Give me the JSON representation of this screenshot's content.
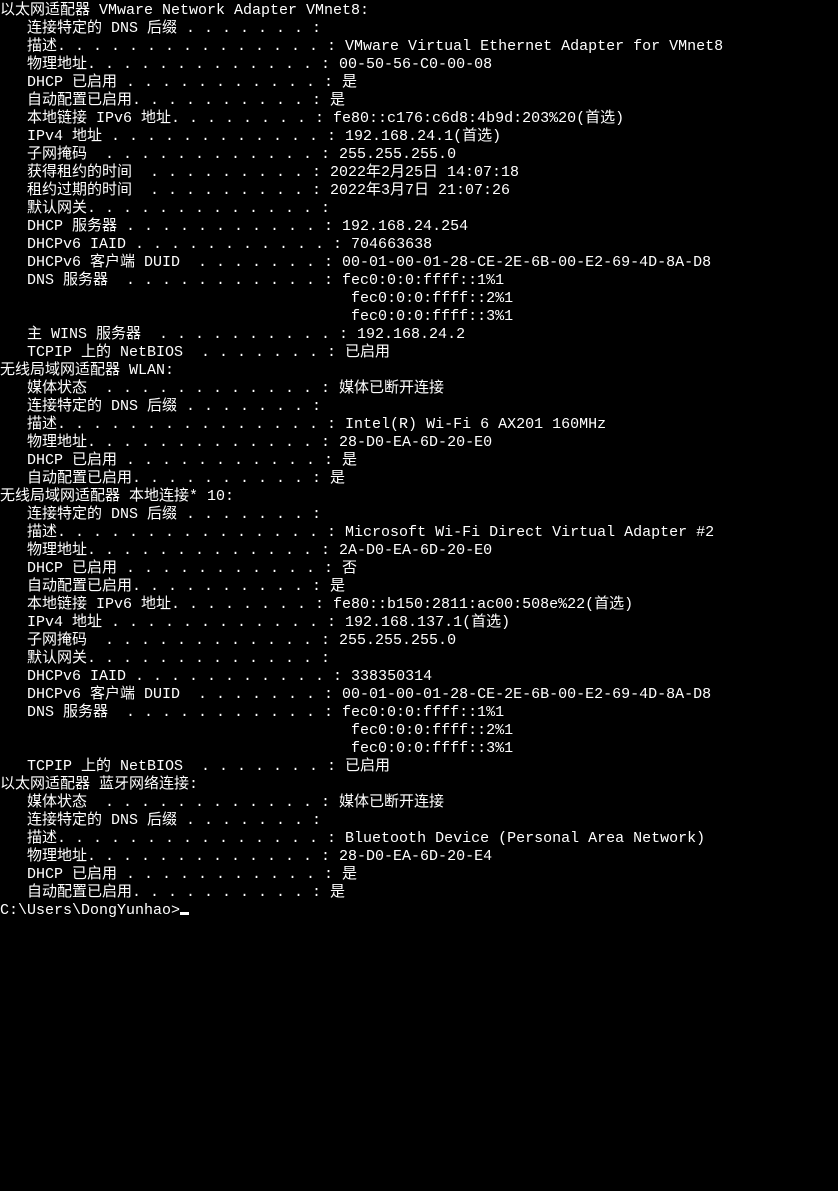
{
  "adapters": [
    {
      "header": "以太网适配器 VMware Network Adapter VMnet8:",
      "rows": [
        {
          "label": "连接特定的 DNS 后缀",
          "dots": " . . . . . . . :",
          "value": "",
          "indent": 3
        },
        {
          "label": "描述",
          "dots": ". . . . . . . . . . . . . . . :",
          "value": " VMware Virtual Ethernet Adapter for VMnet8",
          "indent": 3
        },
        {
          "label": "物理地址",
          "dots": ". . . . . . . . . . . . . :",
          "value": " 00-50-56-C0-00-08",
          "indent": 3
        },
        {
          "label": "DHCP 已启用",
          "dots": " . . . . . . . . . . . :",
          "value": " 是",
          "indent": 3
        },
        {
          "label": "自动配置已启用",
          "dots": ". . . . . . . . . . :",
          "value": " 是",
          "indent": 3
        },
        {
          "label": "本地链接 IPv6 地址",
          "dots": ". . . . . . . . :",
          "value": " fe80::c176:c6d8:4b9d:203%20(首选)",
          "indent": 3
        },
        {
          "label": "IPv4 地址",
          "dots": " . . . . . . . . . . . . :",
          "value": " 192.168.24.1(首选)",
          "indent": 3
        },
        {
          "label": "子网掩码",
          "dots": "  . . . . . . . . . . . . :",
          "value": " 255.255.255.0",
          "indent": 3
        },
        {
          "label": "获得租约的时间",
          "dots": "  . . . . . . . . . :",
          "value": " 2022年2月25日 14:07:18",
          "indent": 3
        },
        {
          "label": "租约过期的时间",
          "dots": "  . . . . . . . . . :",
          "value": " 2022年3月7日 21:07:26",
          "indent": 3
        },
        {
          "label": "默认网关",
          "dots": ". . . . . . . . . . . . . :",
          "value": "",
          "indent": 3
        },
        {
          "label": "DHCP 服务器",
          "dots": " . . . . . . . . . . . :",
          "value": " 192.168.24.254",
          "indent": 3
        },
        {
          "label": "DHCPv6 IAID",
          "dots": " . . . . . . . . . . . :",
          "value": " 704663638",
          "indent": 3
        },
        {
          "label": "DHCPv6 客户端 DUID",
          "dots": "  . . . . . . . :",
          "value": " 00-01-00-01-28-CE-2E-6B-00-E2-69-4D-8A-D8",
          "indent": 3
        },
        {
          "label": "DNS 服务器",
          "dots": "  . . . . . . . . . . . :",
          "value": " fec0:0:0:ffff::1%1",
          "indent": 3
        },
        {
          "label": "",
          "dots": "                                       ",
          "value": "fec0:0:0:ffff::2%1",
          "indent": 0
        },
        {
          "label": "",
          "dots": "                                       ",
          "value": "fec0:0:0:ffff::3%1",
          "indent": 0
        },
        {
          "label": "主 WINS 服务器",
          "dots": "  . . . . . . . . . . :",
          "value": " 192.168.24.2",
          "indent": 3
        },
        {
          "label": "TCPIP 上的 NetBIOS",
          "dots": "  . . . . . . . :",
          "value": " 已启用",
          "indent": 3
        }
      ]
    },
    {
      "header": "无线局域网适配器 WLAN:",
      "rows": [
        {
          "label": "媒体状态",
          "dots": "  . . . . . . . . . . . . :",
          "value": " 媒体已断开连接",
          "indent": 3
        },
        {
          "label": "连接特定的 DNS 后缀",
          "dots": " . . . . . . . :",
          "value": "",
          "indent": 3
        },
        {
          "label": "描述",
          "dots": ". . . . . . . . . . . . . . . :",
          "value": " Intel(R) Wi-Fi 6 AX201 160MHz",
          "indent": 3
        },
        {
          "label": "物理地址",
          "dots": ". . . . . . . . . . . . . :",
          "value": " 28-D0-EA-6D-20-E0",
          "indent": 3
        },
        {
          "label": "DHCP 已启用",
          "dots": " . . . . . . . . . . . :",
          "value": " 是",
          "indent": 3
        },
        {
          "label": "自动配置已启用",
          "dots": ". . . . . . . . . . :",
          "value": " 是",
          "indent": 3
        }
      ]
    },
    {
      "header": "无线局域网适配器 本地连接* 10:",
      "rows": [
        {
          "label": "连接特定的 DNS 后缀",
          "dots": " . . . . . . . :",
          "value": "",
          "indent": 3
        },
        {
          "label": "描述",
          "dots": ". . . . . . . . . . . . . . . :",
          "value": " Microsoft Wi-Fi Direct Virtual Adapter #2",
          "indent": 3
        },
        {
          "label": "物理地址",
          "dots": ". . . . . . . . . . . . . :",
          "value": " 2A-D0-EA-6D-20-E0",
          "indent": 3
        },
        {
          "label": "DHCP 已启用",
          "dots": " . . . . . . . . . . . :",
          "value": " 否",
          "indent": 3
        },
        {
          "label": "自动配置已启用",
          "dots": ". . . . . . . . . . :",
          "value": " 是",
          "indent": 3
        },
        {
          "label": "本地链接 IPv6 地址",
          "dots": ". . . . . . . . :",
          "value": " fe80::b150:2811:ac00:508e%22(首选)",
          "indent": 3
        },
        {
          "label": "IPv4 地址",
          "dots": " . . . . . . . . . . . . :",
          "value": " 192.168.137.1(首选)",
          "indent": 3
        },
        {
          "label": "子网掩码",
          "dots": "  . . . . . . . . . . . . :",
          "value": " 255.255.255.0",
          "indent": 3
        },
        {
          "label": "默认网关",
          "dots": ". . . . . . . . . . . . . :",
          "value": "",
          "indent": 3
        },
        {
          "label": "DHCPv6 IAID",
          "dots": " . . . . . . . . . . . :",
          "value": " 338350314",
          "indent": 3
        },
        {
          "label": "DHCPv6 客户端 DUID",
          "dots": "  . . . . . . . :",
          "value": " 00-01-00-01-28-CE-2E-6B-00-E2-69-4D-8A-D8",
          "indent": 3
        },
        {
          "label": "DNS 服务器",
          "dots": "  . . . . . . . . . . . :",
          "value": " fec0:0:0:ffff::1%1",
          "indent": 3
        },
        {
          "label": "",
          "dots": "                                       ",
          "value": "fec0:0:0:ffff::2%1",
          "indent": 0
        },
        {
          "label": "",
          "dots": "                                       ",
          "value": "fec0:0:0:ffff::3%1",
          "indent": 0
        },
        {
          "label": "TCPIP 上的 NetBIOS",
          "dots": "  . . . . . . . :",
          "value": " 已启用",
          "indent": 3
        }
      ]
    },
    {
      "header": "以太网适配器 蓝牙网络连接:",
      "rows": [
        {
          "label": "媒体状态",
          "dots": "  . . . . . . . . . . . . :",
          "value": " 媒体已断开连接",
          "indent": 3
        },
        {
          "label": "连接特定的 DNS 后缀",
          "dots": " . . . . . . . :",
          "value": "",
          "indent": 3
        },
        {
          "label": "描述",
          "dots": ". . . . . . . . . . . . . . . :",
          "value": " Bluetooth Device (Personal Area Network)",
          "indent": 3
        },
        {
          "label": "物理地址",
          "dots": ". . . . . . . . . . . . . :",
          "value": " 28-D0-EA-6D-20-E4",
          "indent": 3
        },
        {
          "label": "DHCP 已启用",
          "dots": " . . . . . . . . . . . :",
          "value": " 是",
          "indent": 3
        },
        {
          "label": "自动配置已启用",
          "dots": ". . . . . . . . . . :",
          "value": " 是",
          "indent": 3
        }
      ]
    }
  ],
  "prompt": "C:\\Users\\DongYunhao>"
}
